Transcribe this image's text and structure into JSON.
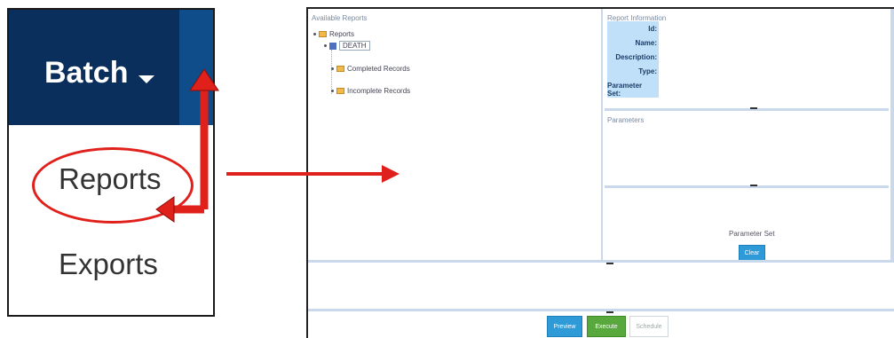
{
  "menu": {
    "title": "Batch",
    "items": [
      {
        "label": "Reports"
      },
      {
        "label": "Exports"
      }
    ]
  },
  "app": {
    "available_reports": {
      "title": "Available Reports",
      "root": "Reports",
      "db": "DEATH",
      "folders": [
        "Completed Records",
        "Incomplete Records"
      ]
    },
    "report_information": {
      "title": "Report Information",
      "labels": [
        "Id:",
        "Name:",
        "Description:",
        "Type:",
        "Parameter Set:"
      ]
    },
    "parameters": {
      "title": "Parameters"
    },
    "parameter_set": {
      "title": "Parameter Set",
      "clear_label": "Clear"
    },
    "footer": {
      "preview_label": "Preview",
      "execute_label": "Execute",
      "schedule_label": "Schedule"
    }
  },
  "colors": {
    "menu_header": "#0b2f5c",
    "annotation_red": "#e0201b",
    "primary_blue": "#2e9ad8",
    "execute_green": "#58a83e"
  }
}
